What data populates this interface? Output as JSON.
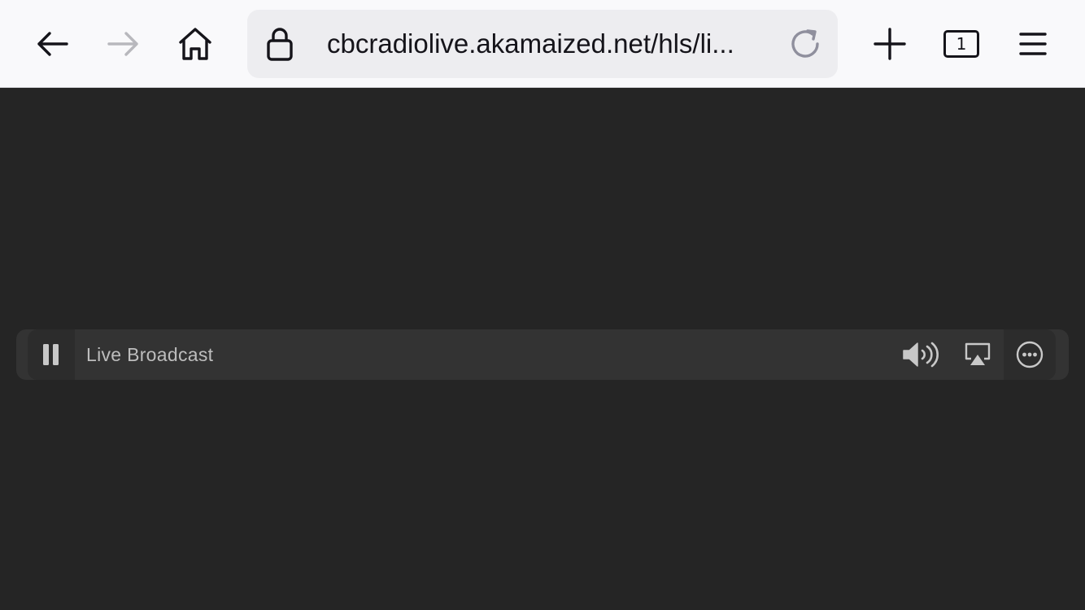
{
  "toolbar": {
    "back_icon": "arrow-left-icon",
    "forward_icon": "arrow-right-icon",
    "home_icon": "home-icon",
    "new_tab_icon": "plus-icon",
    "tabs_count": "1",
    "menu_icon": "hamburger-menu-icon"
  },
  "urlbar": {
    "lock_icon": "lock-icon",
    "url": "cbcradiolive.akamaized.net/hls/li...",
    "reload_icon": "reload-icon"
  },
  "player": {
    "pause_icon": "pause-icon",
    "status_label": "Live Broadcast",
    "volume_icon": "speaker-volume-icon",
    "airplay_icon": "airplay-icon",
    "more_icon": "more-options-icon"
  },
  "colors": {
    "toolbar_bg": "#f9f9fb",
    "urlbar_bg": "#ededf0",
    "content_bg": "#252525",
    "player_bg": "#333333",
    "icon_dark": "#15141a",
    "icon_disabled": "#b8b8bd",
    "player_icon": "#c8c8c8"
  }
}
